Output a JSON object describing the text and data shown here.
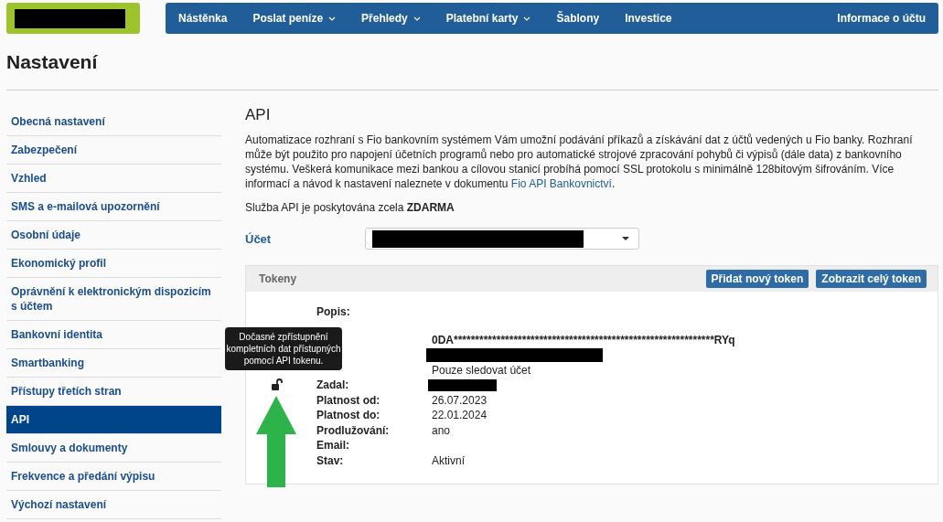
{
  "nav": {
    "items": [
      {
        "label": "Nástěnka",
        "dropdown": false
      },
      {
        "label": "Poslat peníze",
        "dropdown": true
      },
      {
        "label": "Přehledy",
        "dropdown": true
      },
      {
        "label": "Platební karty",
        "dropdown": true
      },
      {
        "label": "Šablony",
        "dropdown": false
      },
      {
        "label": "Investice",
        "dropdown": false
      }
    ],
    "account": "Informace o účtu"
  },
  "page_title": "Nastavení",
  "sidebar": {
    "items": [
      {
        "label": "Obecná nastavení",
        "selected": false
      },
      {
        "label": "Zabezpečení",
        "selected": false
      },
      {
        "label": "Vzhled",
        "selected": false
      },
      {
        "label": "SMS a e-mailová upozornění",
        "selected": false
      },
      {
        "label": "Osobní údaje",
        "selected": false
      },
      {
        "label": "Ekonomický profil",
        "selected": false
      },
      {
        "label": "Oprávnění k elektronickým dispozicím s účtem",
        "selected": false
      },
      {
        "label": "Bankovní identita",
        "selected": false
      },
      {
        "label": "Smartbanking",
        "selected": false
      },
      {
        "label": "Přístupy třetích stran",
        "selected": false
      },
      {
        "label": "API",
        "selected": true
      },
      {
        "label": "Smlouvy a dokumenty",
        "selected": false
      },
      {
        "label": "Frekvence a předání výpisu",
        "selected": false
      },
      {
        "label": "Výchozí nastavení",
        "selected": false
      }
    ]
  },
  "section_title": "API",
  "description": "Automatizace rozhraní s Fio bankovním systémem Vám umožní podávání příkazů a získávání dat z účtů vedených u Fio banky. Rozhraní může být použito pro napojení účetních programů nebo pro automatické strojové zpracování pohybů či výpisů (dále data) z bankovního systému. Veškerá komunikace mezi bankou a cílovou stanicí probíhá pomocí SSL protokolu s minimálně 128bitovým šifrováním. Více informací a návod k nastavení naleznete v dokumentu",
  "description_link": "Fio API Bankovnictví",
  "description_end": ".",
  "free_note": "Služba API je poskytována zcela **ZDARMA**",
  "account_label": "Účet",
  "tokens": {
    "title": "Tokeny",
    "buttons": [
      "Přidat nový token",
      "Zobrazit celý token"
    ],
    "tooltip": "Dočasné zpřístupnění kompletních dat přístupných pomocí API tokenu.",
    "fields": [
      {
        "label": "Popis:",
        "kind": "text"
      },
      {
        "kind": "token",
        "value": "0DA*************************************************************RYq"
      },
      {
        "kind": "redacted"
      },
      {
        "kind": "text",
        "value": "Pouze sledovat účet"
      },
      {
        "label": "Zadal:",
        "kind": "redacted"
      },
      {
        "label": "Platnost od:",
        "kind": "text",
        "value": "26.07.2023"
      },
      {
        "label": "Platnost do:",
        "kind": "text",
        "value": "22.01.2024"
      },
      {
        "label": "Prodlužování:",
        "kind": "text",
        "value": "ano"
      },
      {
        "label": "Email:",
        "kind": "text"
      },
      {
        "label": "Stav:",
        "kind": "text",
        "value": "Aktivní"
      }
    ]
  }
}
